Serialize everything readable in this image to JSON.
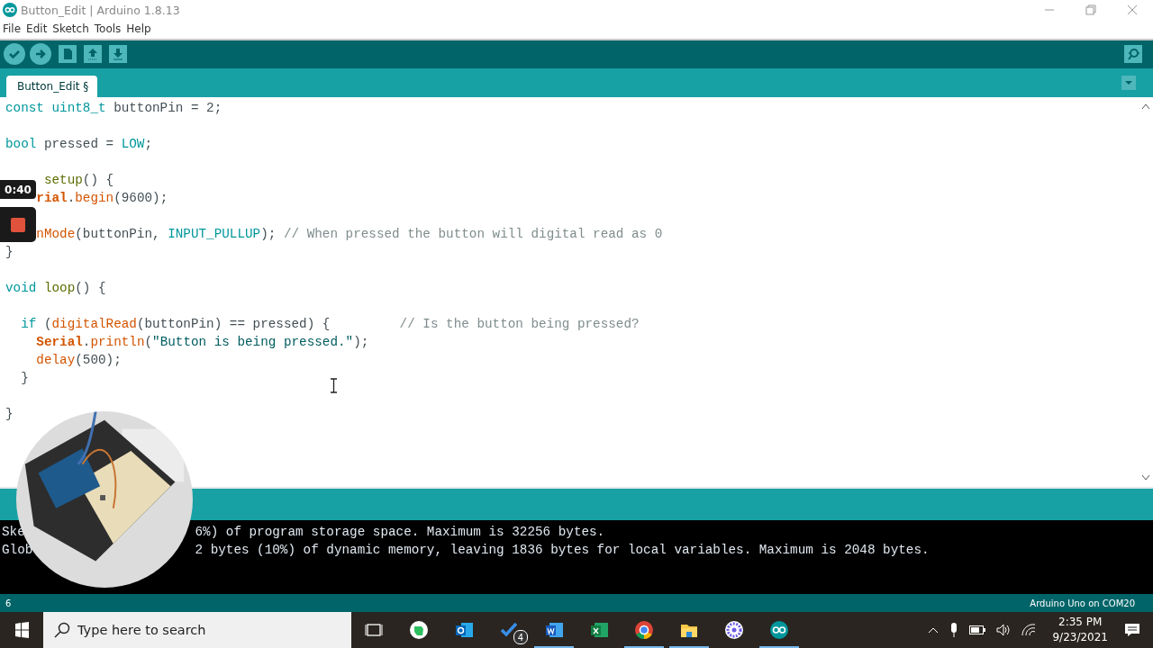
{
  "window": {
    "title": "Button_Edit | Arduino 1.8.13"
  },
  "menu": [
    "File",
    "Edit",
    "Sketch",
    "Tools",
    "Help"
  ],
  "toolbar": [
    {
      "kind": "verify"
    },
    {
      "kind": "upload"
    },
    {
      "kind": "new"
    },
    {
      "kind": "open"
    },
    {
      "kind": "save"
    }
  ],
  "tabs": [
    {
      "label": "Button_Edit §",
      "selected": true
    }
  ],
  "editor": {
    "lines": [
      {
        "kind": "code",
        "tokens": [
          {
            "kind": "type",
            "text": "const"
          },
          {
            "kind": "type",
            "text": " uint8_t"
          },
          {
            "kind": "plain",
            "text": " buttonPin = 2;"
          }
        ]
      },
      {
        "kind": "blank"
      },
      {
        "kind": "code",
        "tokens": [
          {
            "kind": "type",
            "text": "bool"
          },
          {
            "kind": "plain",
            "text": " pressed = "
          },
          {
            "kind": "const",
            "text": "LOW"
          },
          {
            "kind": "plain",
            "text": ";"
          }
        ]
      },
      {
        "kind": "blank"
      },
      {
        "kind": "code",
        "tokens": [
          {
            "kind": "func",
            "text": "     setup"
          },
          {
            "kind": "plain",
            "text": "() {"
          }
        ]
      },
      {
        "kind": "code",
        "tokens": [
          {
            "kind": "serial",
            "text": "    rial"
          },
          {
            "kind": "plain",
            "text": "."
          },
          {
            "kind": "builtin",
            "text": "begin"
          },
          {
            "kind": "plain",
            "text": "(9600);"
          }
        ]
      },
      {
        "kind": "blank"
      },
      {
        "kind": "code",
        "tokens": [
          {
            "kind": "builtin",
            "text": "    nMode"
          },
          {
            "kind": "plain",
            "text": "(buttonPin, "
          },
          {
            "kind": "const",
            "text": "INPUT_PULLUP"
          },
          {
            "kind": "plain",
            "text": "); "
          },
          {
            "kind": "comment",
            "text": "// When pressed the button will digital read as 0"
          }
        ]
      },
      {
        "kind": "code",
        "tokens": [
          {
            "kind": "plain",
            "text": "}"
          }
        ]
      },
      {
        "kind": "blank"
      },
      {
        "kind": "code",
        "tokens": [
          {
            "kind": "type",
            "text": "void"
          },
          {
            "kind": "func",
            "text": " loop"
          },
          {
            "kind": "plain",
            "text": "() {"
          }
        ]
      },
      {
        "kind": "blank"
      },
      {
        "kind": "code",
        "tokens": [
          {
            "kind": "type",
            "text": "  if"
          },
          {
            "kind": "plain",
            "text": " ("
          },
          {
            "kind": "builtin",
            "text": "digitalRead"
          },
          {
            "kind": "plain",
            "text": "(buttonPin) == pressed) {         "
          },
          {
            "kind": "comment",
            "text": "// Is the button being pressed?"
          }
        ]
      },
      {
        "kind": "code",
        "tokens": [
          {
            "kind": "serial",
            "text": "    Serial"
          },
          {
            "kind": "plain",
            "text": "."
          },
          {
            "kind": "builtin",
            "text": "println"
          },
          {
            "kind": "plain",
            "text": "("
          },
          {
            "kind": "string",
            "text": "\"Button is being pressed.\""
          },
          {
            "kind": "plain",
            "text": ");"
          }
        ]
      },
      {
        "kind": "code",
        "tokens": [
          {
            "kind": "builtin",
            "text": "    delay"
          },
          {
            "kind": "plain",
            "text": "(500);"
          }
        ]
      },
      {
        "kind": "code",
        "tokens": [
          {
            "kind": "plain",
            "text": "  }"
          }
        ]
      },
      {
        "kind": "blank"
      },
      {
        "kind": "code",
        "tokens": [
          {
            "kind": "plain",
            "text": "}"
          }
        ]
      }
    ]
  },
  "console": {
    "lines": [
      {
        "segments": [
          "Ske",
          "6%) of program storage space. Maximum is 32256 bytes."
        ]
      },
      {
        "segments": [
          "Glob",
          "2 bytes (10%) of dynamic memory, leaving 1836 bytes for local variables. Maximum is 2048 bytes."
        ]
      }
    ]
  },
  "status_bar": {
    "line": "6",
    "board": "Arduino Uno on COM20"
  },
  "recording": {
    "time": "0:40"
  },
  "taskbar": {
    "search": {
      "placeholder": "Type here to search"
    },
    "apps": [
      {
        "kind": "taskview",
        "running": false
      },
      {
        "kind": "evernote",
        "running": false
      },
      {
        "kind": "outlook",
        "running": false
      },
      {
        "kind": "todo",
        "running": false,
        "badge": "4"
      },
      {
        "kind": "word",
        "running": true
      },
      {
        "kind": "excel",
        "running": false
      },
      {
        "kind": "chrome",
        "running": true
      },
      {
        "kind": "explorer",
        "running": true
      },
      {
        "kind": "flower",
        "running": false
      },
      {
        "kind": "arduino",
        "running": true
      }
    ],
    "clock": {
      "time": "2:35 PM",
      "date": "9/23/2021"
    }
  }
}
